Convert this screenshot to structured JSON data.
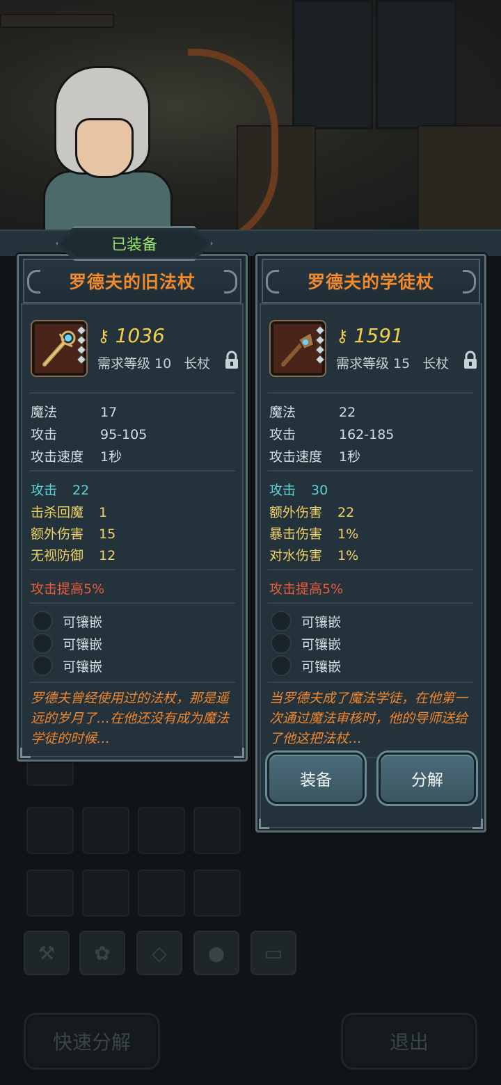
{
  "equipped_tag": "已装备",
  "left_item": {
    "name": "罗德夫的旧法杖",
    "power": "1036",
    "req_level": "需求等级 10",
    "type": "长杖",
    "base_stats": [
      {
        "label": "魔法",
        "value": "17"
      },
      {
        "label": "攻击",
        "value": "95-105"
      },
      {
        "label": "攻击速度",
        "value": "1秒"
      }
    ],
    "attrs": [
      {
        "label": "攻击",
        "value": "22",
        "color": "cyan"
      },
      {
        "label": "击杀回魔",
        "value": "1",
        "color": "yellow"
      },
      {
        "label": "额外伤害",
        "value": "15",
        "color": "yellow"
      },
      {
        "label": "无视防御",
        "value": "12",
        "color": "yellow"
      }
    ],
    "bonus": "攻击提高5%",
    "sockets": [
      "可镶嵌",
      "可镶嵌",
      "可镶嵌"
    ],
    "description": "罗德夫曾经使用过的法杖，那是遥远的岁月了…在他还没有成为魔法学徒的时候…"
  },
  "right_item": {
    "name": "罗德夫的学徒杖",
    "power": "1591",
    "req_level": "需求等级 15",
    "type": "长杖",
    "base_stats": [
      {
        "label": "魔法",
        "value": "22"
      },
      {
        "label": "攻击",
        "value": "162-185"
      },
      {
        "label": "攻击速度",
        "value": "1秒"
      }
    ],
    "attrs": [
      {
        "label": "攻击",
        "value": "30",
        "color": "cyan"
      },
      {
        "label": "额外伤害",
        "value": "22",
        "color": "yellow"
      },
      {
        "label": "暴击伤害",
        "value": "1%",
        "color": "yellow"
      },
      {
        "label": "对水伤害",
        "value": "1%",
        "color": "yellow"
      }
    ],
    "bonus": "攻击提高5%",
    "sockets": [
      "可镶嵌",
      "可镶嵌",
      "可镶嵌"
    ],
    "description": "当罗德夫成了魔法学徒，在他第一次通过魔法审核时，他的导师送给了他这把法杖…",
    "equip_label": "装备",
    "decompose_label": "分解"
  },
  "bottom": {
    "quick_decompose_label": "快速分解",
    "exit_label": "退出"
  },
  "category_tabs": [
    {
      "icon": "weapon-icon"
    },
    {
      "icon": "paw-icon"
    },
    {
      "icon": "gem-icon"
    },
    {
      "icon": "material-icon"
    },
    {
      "icon": "chest-icon"
    }
  ],
  "colors": {
    "title": "#f28a2a",
    "power": "#f2cf4a",
    "attr_primary": "#5fd0d6",
    "attr_secondary": "#efd267",
    "bonus": "#ea5a3a",
    "description": "#f0862e",
    "equipped": "#9be66a"
  }
}
